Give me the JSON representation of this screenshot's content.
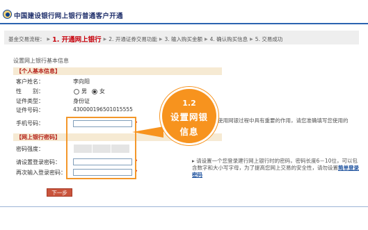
{
  "header": {
    "title": "中国建设银行网上银行普通客户开通"
  },
  "steps": {
    "prefix": "基金交易流程：",
    "items": [
      {
        "label": "1. 开通网上银行",
        "current": true
      },
      {
        "label": "2. 开通证券交易功能",
        "current": false
      },
      {
        "label": "3. 输入购买金额",
        "current": false
      },
      {
        "label": "4. 确认购买信息",
        "current": false
      },
      {
        "label": "5. 交易成功",
        "current": false
      }
    ]
  },
  "section_title": "设置网上银行基本信息",
  "personal": {
    "category": "【个人基本信息】",
    "name_label": "客户姓名：",
    "name_value": "李向阳",
    "gender_label": "性　　别：",
    "gender_male": "男",
    "gender_female": "女",
    "gender_selected": "女",
    "idtype_label": "证件类型：",
    "idtype_value": "身份证",
    "idno_label": "证件号码：",
    "idno_value": "430000196501015555",
    "phone_label": "手机号码：",
    "phone_value": "",
    "phone_hint": "使用网银过程中具有重要的作用，请您准确填写您使用的"
  },
  "password": {
    "category": "【网上银行密码】",
    "strength_label": "密码强度：",
    "set_label": "请设置登录密码：",
    "confirm_label": "再次输入登录密码：",
    "hint_text": "请设置一个您登录建行网上银行时的密码，密码长度6－10位，可以包含数字和大小写字母，为了提高您网上交易的安全性，请勿设置",
    "hint_link": "简单登录密码"
  },
  "callout": {
    "number": "1.2",
    "line1": "设置网银",
    "line2": "信息"
  },
  "next_button": "下一步",
  "colors": {
    "accent_red": "#c7000b",
    "callout_orange": "#f7931e",
    "link_blue": "#1a4f9c"
  }
}
